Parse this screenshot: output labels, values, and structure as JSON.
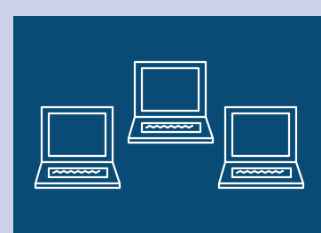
{
  "icons": [
    {
      "name": "laptop-icon",
      "description": "laptop"
    },
    {
      "name": "laptop-icon",
      "description": "laptop"
    },
    {
      "name": "laptop-icon",
      "description": "laptop"
    }
  ],
  "colors": {
    "outer_background": "#cdd0ea",
    "panel_background": "#0a4b75",
    "line": "#ffffff"
  }
}
